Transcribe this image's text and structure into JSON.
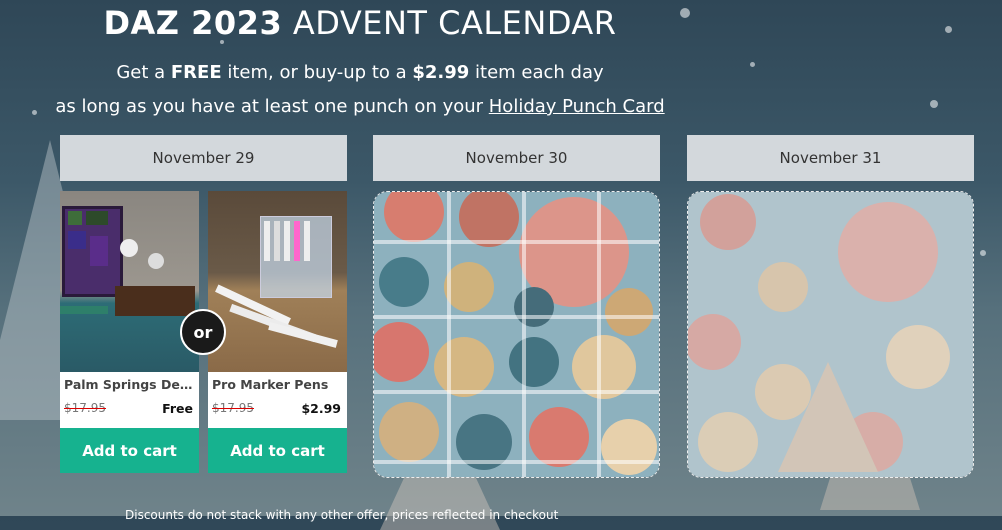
{
  "title": {
    "bold": "DAZ 2023",
    "rest": "ADVENT CALENDAR"
  },
  "subtitle": {
    "line1_pre": "Get a ",
    "line1_free": "FREE",
    "line1_mid": " item, or buy-up to a ",
    "line1_price": "$2.99",
    "line1_post": " item each day",
    "line2_pre": "as long as you have at least one punch on your ",
    "line2_link": "Holiday Punch Card"
  },
  "days": [
    {
      "label": "November 29"
    },
    {
      "label": "November 30"
    },
    {
      "label": "November 31"
    }
  ],
  "products": [
    {
      "name": "Palm Springs Dec…",
      "old_price": "$17.95",
      "new_price": "Free",
      "button": "Add to cart"
    },
    {
      "name": "Pro Marker Pens",
      "old_price": "$17.95",
      "new_price": "$2.99",
      "button": "Add to cart"
    }
  ],
  "or_label": "or",
  "bottom_text": "Discounts do not stack with any other offer, prices reflected in checkout",
  "colors": {
    "cart_button": "#16b28f",
    "day_header": "#d3d8dc"
  }
}
